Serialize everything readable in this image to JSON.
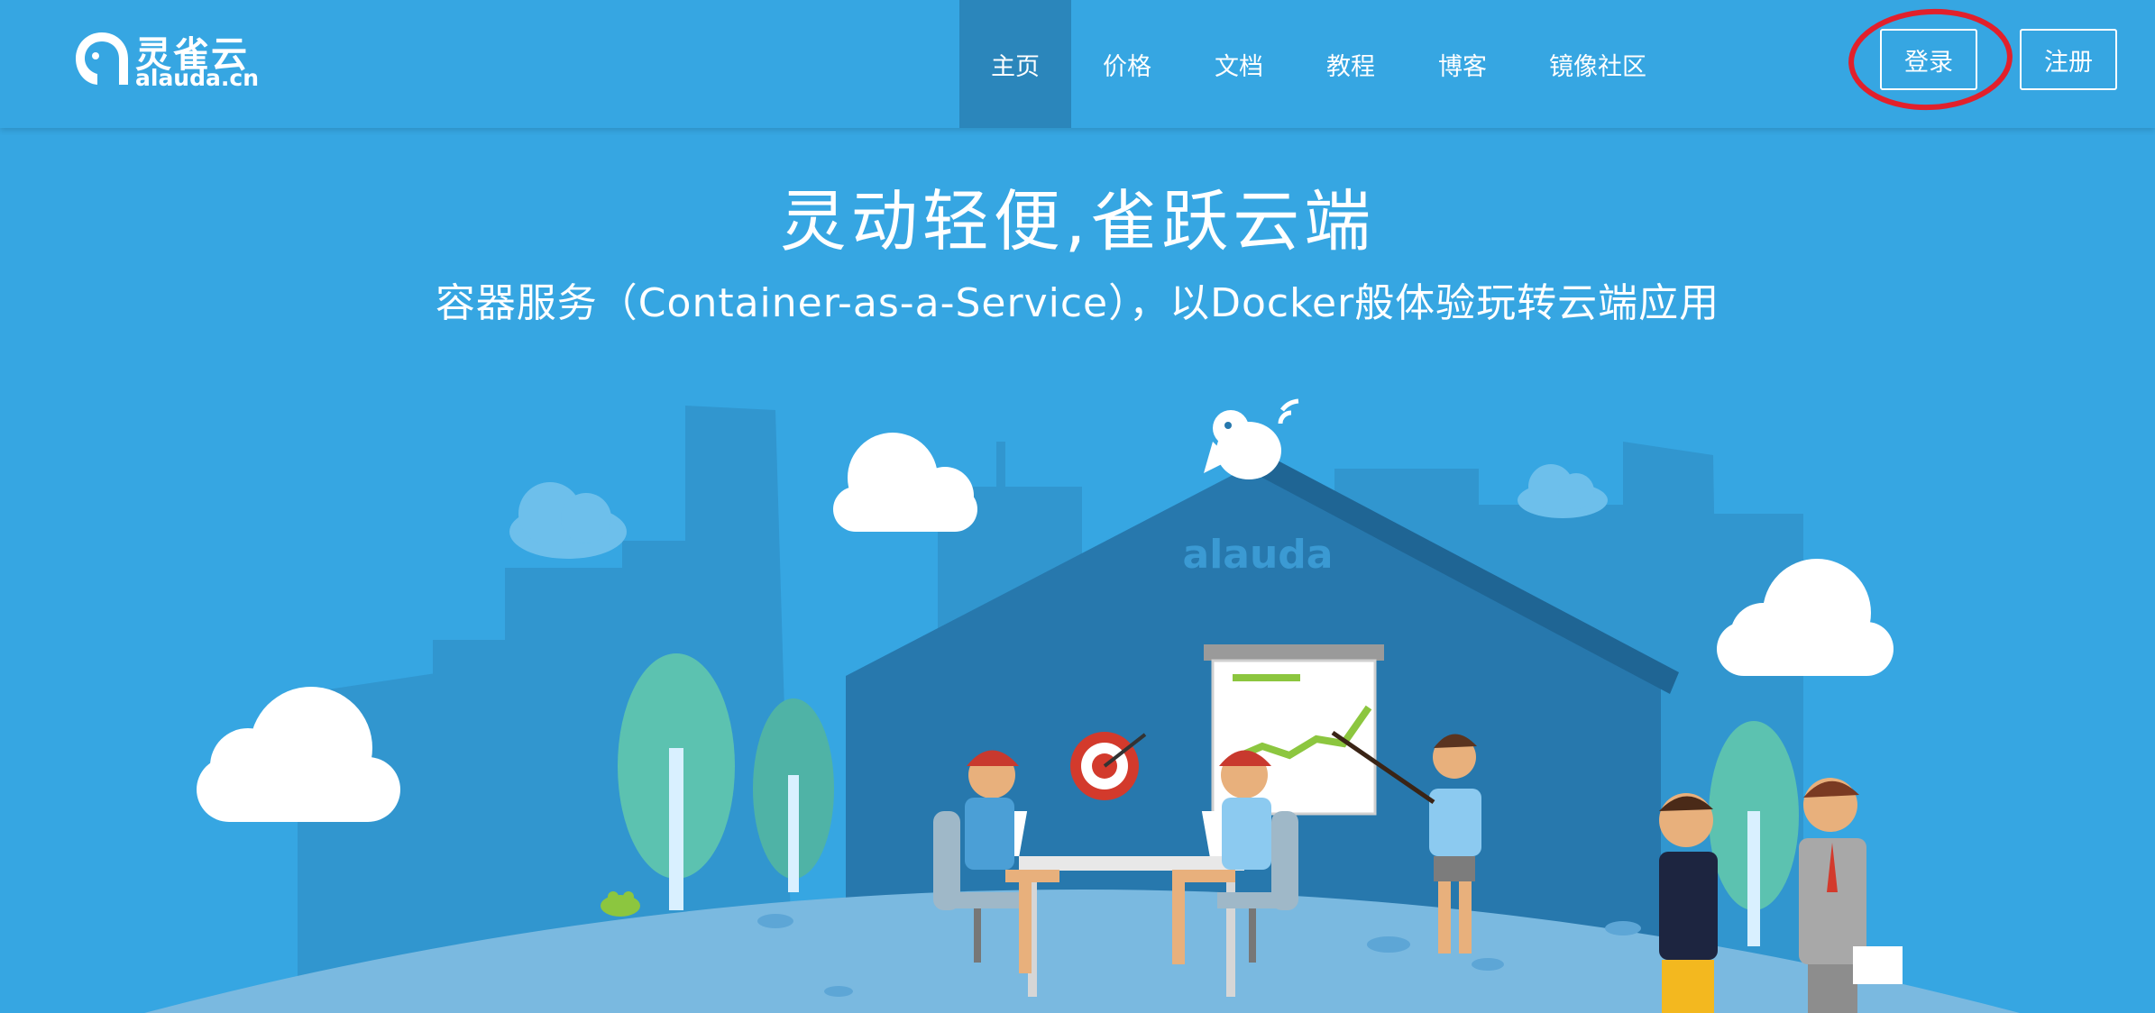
{
  "header": {
    "logo": {
      "name_cn": "灵雀云",
      "domain": "alauda.cn"
    },
    "nav": [
      {
        "label": "主页",
        "active": true
      },
      {
        "label": "价格",
        "active": false
      },
      {
        "label": "文档",
        "active": false
      },
      {
        "label": "教程",
        "active": false
      },
      {
        "label": "博客",
        "active": false
      },
      {
        "label": "镜像社区",
        "active": false
      }
    ],
    "login_label": "登录",
    "signup_label": "注册"
  },
  "hero": {
    "title": "灵动轻便,雀跃云端",
    "subtitle": "容器服务（Container-as-a-Service），以Docker般体验玩转云端应用",
    "house_sign": "alauda"
  },
  "annotation": {
    "target": "login-button",
    "color": "#e2202b"
  },
  "colors": {
    "background": "#36a6e2",
    "nav_active": "#2b86bb",
    "house": "#2778ad",
    "ground": "#7ab9e0",
    "chart_line": "#8cc63f"
  }
}
